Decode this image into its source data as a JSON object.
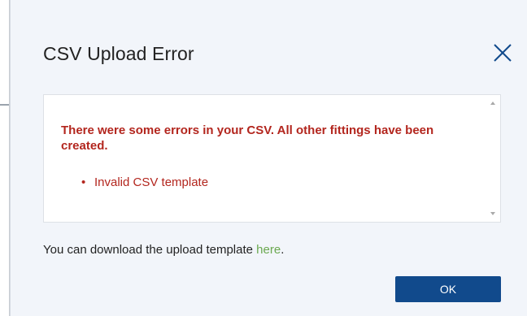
{
  "dialog": {
    "title": "CSV Upload Error",
    "close_icon": "close-icon",
    "error_panel": {
      "heading": "There were some errors in your CSV. All other fittings have been created.",
      "errors": [
        "Invalid CSV template"
      ]
    },
    "footer": {
      "text_before": "You can download the upload template ",
      "link_label": "here",
      "text_after": "."
    },
    "ok_label": "OK"
  },
  "colors": {
    "dialog_background": "#f2f5fa",
    "error_text": "#b3261e",
    "link": "#6aa84f",
    "primary_button": "#114a8c",
    "close_icon": "#114a8c"
  }
}
